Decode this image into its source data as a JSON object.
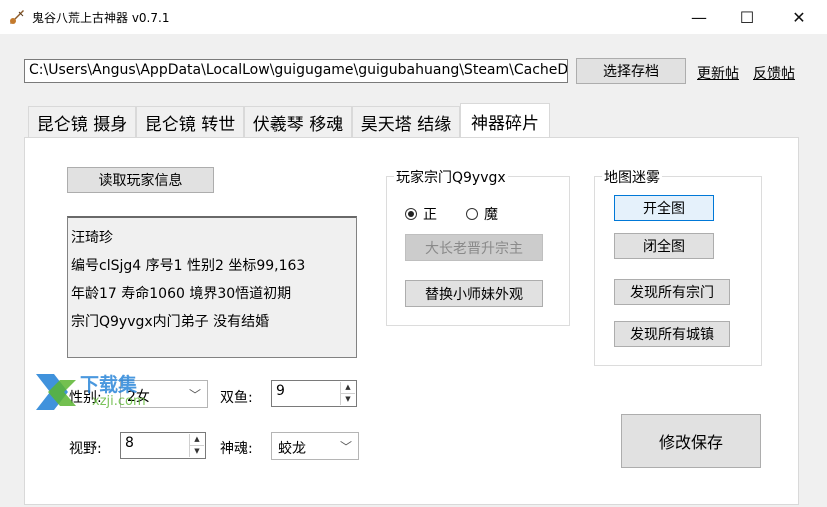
{
  "window": {
    "title": "鬼谷八荒上古神器 v0.7.1",
    "minimize": "—",
    "maximize": "☐",
    "close": "✕"
  },
  "toolbar": {
    "path_value": "C:\\Users\\Angus\\AppData\\LocalLow\\guigugame\\guigubahuang\\Steam\\CacheD",
    "select_save_label": "选择存档",
    "update_link": "更新帖",
    "feedback_link": "反馈帖"
  },
  "tabs": [
    {
      "label": "昆仑镜 摄身",
      "active": false
    },
    {
      "label": "昆仑镜 转世",
      "active": false
    },
    {
      "label": "伏羲琴 移魂",
      "active": false
    },
    {
      "label": "昊天塔 结缘",
      "active": false
    },
    {
      "label": "神器碎片",
      "active": true
    }
  ],
  "player": {
    "read_button": "读取玩家信息",
    "info_lines": [
      "汪琦珍",
      "编号clSjg4 序号1 性别2 坐标99,163",
      "年龄17 寿命1060 境界30悟道初期",
      "宗门Q9yvgx内门弟子 没有结婚"
    ]
  },
  "sect_group": {
    "legend": "玩家宗门Q9yvgx",
    "radio_zheng": "正",
    "radio_mo": "魔",
    "selected": "正",
    "promote_button": "大长老晋升宗主",
    "replace_button": "替换小师妹外观"
  },
  "map_group": {
    "legend": "地图迷雾",
    "open_all": "开全图",
    "close_all": "闭全图",
    "discover_sects": "发现所有宗门",
    "discover_towns": "发现所有城镇"
  },
  "fields": {
    "gender_label": "性别:",
    "gender_value": "2女",
    "shuangyu_label": "双鱼:",
    "shuangyu_value": "9",
    "vision_label": "视野:",
    "vision_value": "8",
    "shenhun_label": "神魂:",
    "shenhun_value": "蛟龙"
  },
  "save_button": "修改保存",
  "watermark": {
    "text": "下载集",
    "sub": "xzji.com"
  },
  "colors": {
    "accent": "#0078d7",
    "watermark_blue": "#1e7fd6",
    "watermark_green": "#5bb531"
  }
}
